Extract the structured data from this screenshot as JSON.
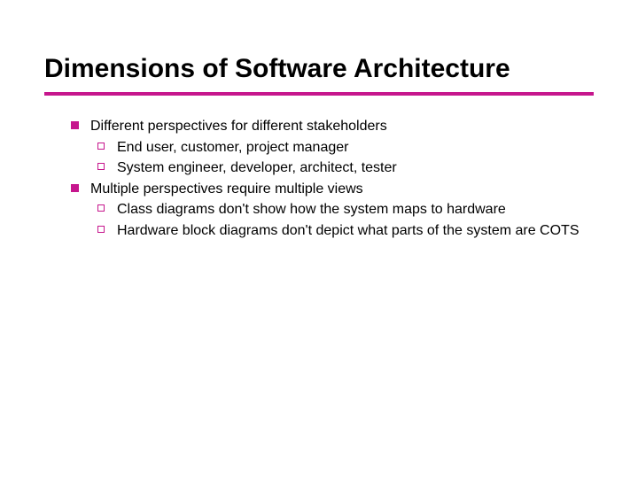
{
  "title": "Dimensions of Software Architecture",
  "items": [
    {
      "text": "Different perspectives for different stakeholders",
      "sub": [
        "End user, customer, project manager",
        "System engineer, developer, architect, tester"
      ]
    },
    {
      "text": "Multiple perspectives require multiple views",
      "sub": [
        "Class diagrams don't show how the system maps to hardware",
        "Hardware block diagrams don't depict what parts of the system are COTS"
      ]
    }
  ]
}
